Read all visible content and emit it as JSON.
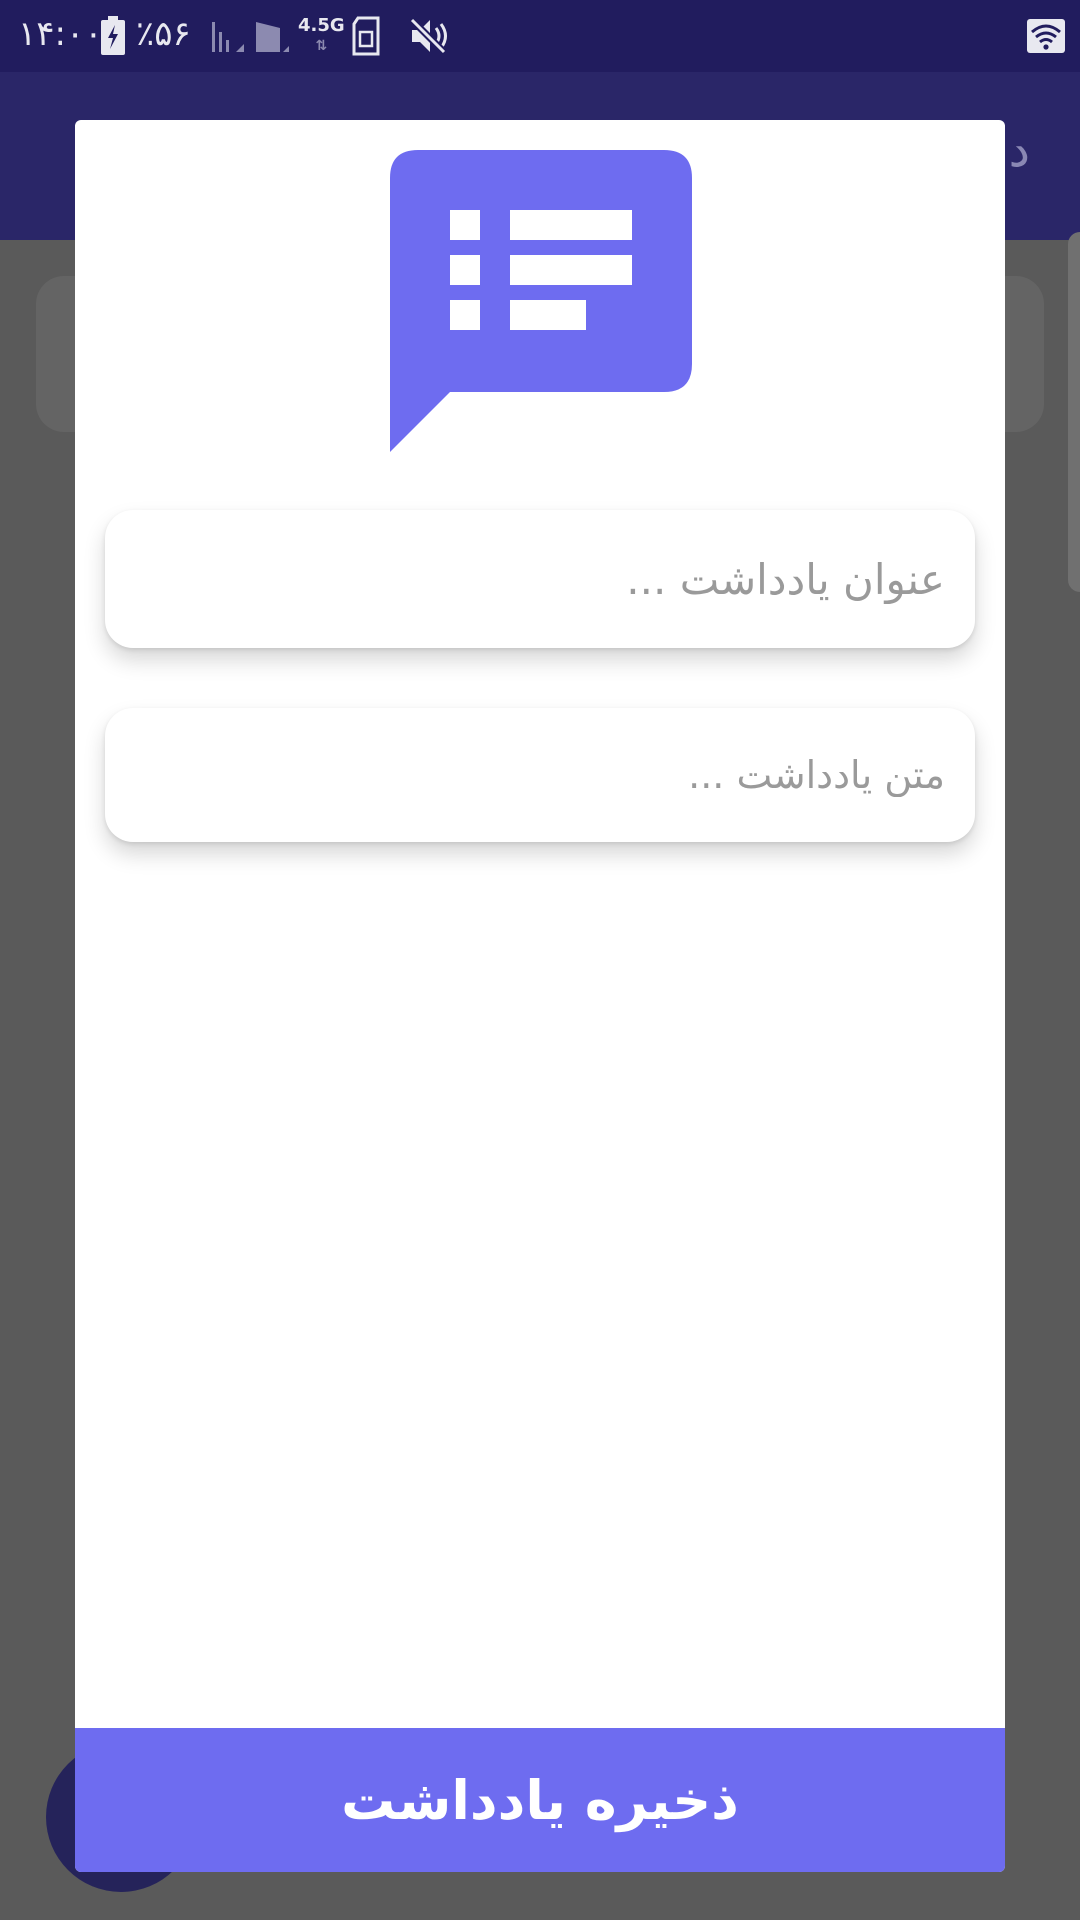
{
  "status_bar": {
    "time": "۱۴:۰۰",
    "battery_percent": "٪۵۶",
    "network": "4.5G",
    "network_arrows": "⇅"
  },
  "app_bar": {
    "title_partial": "د"
  },
  "dialog": {
    "title_field": {
      "value": "",
      "placeholder": "عنوان یادداشت ..."
    },
    "body_field": {
      "value": "",
      "placeholder": "متن یادداشت ..."
    },
    "save_button_label": "ذخیره یادداشت"
  },
  "colors": {
    "accent": "#6e6cf0",
    "status_bar": "#211c5e",
    "app_bar": "#2a2668",
    "scrim": "#5a5a5a"
  },
  "icons": {
    "dialog_icon": "note-list-chat-icon"
  }
}
